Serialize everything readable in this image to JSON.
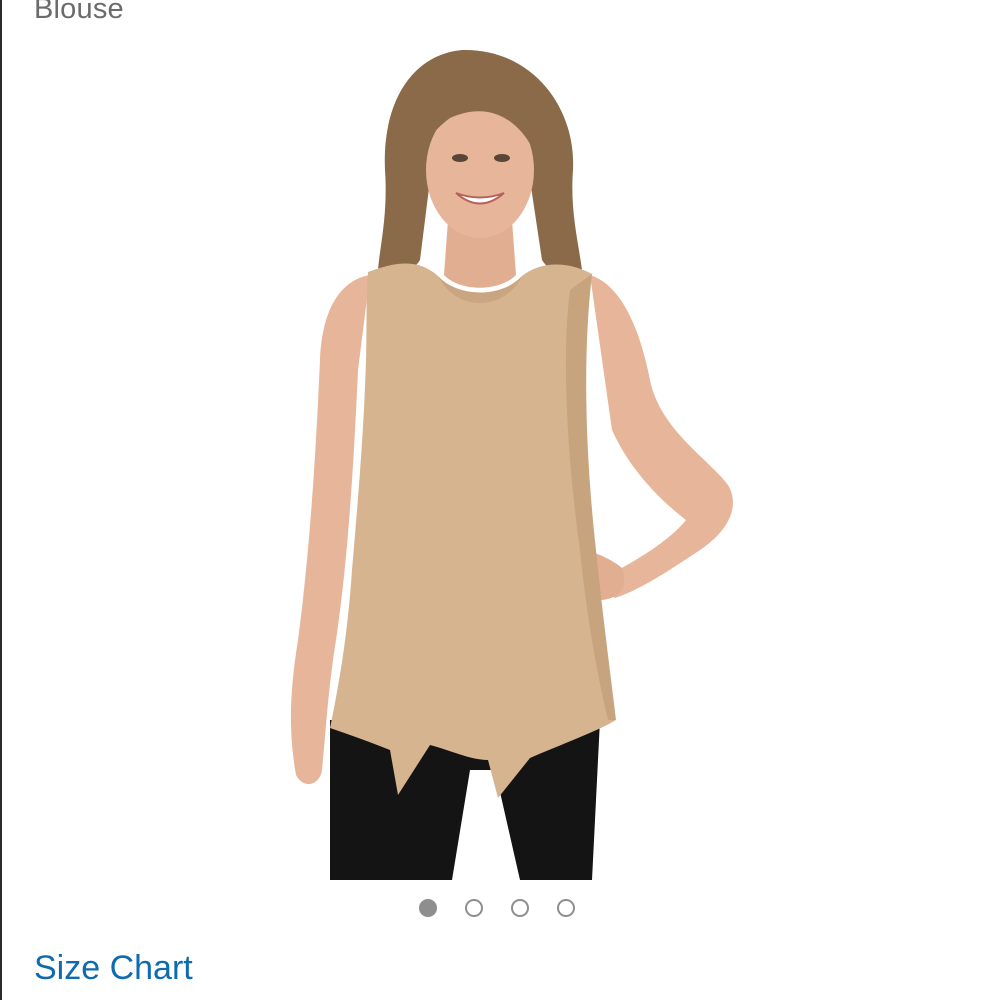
{
  "product": {
    "title": "Blouse"
  },
  "image": {
    "subject": "woman-wearing-sleeveless-tan-blouse",
    "colors": {
      "blouse": "#d6b48f",
      "pants": "#141414",
      "skin": "#e7b69a",
      "hair": "#8a6a48"
    }
  },
  "carousel": {
    "total": 4,
    "active_index": 0
  },
  "links": {
    "size_chart": "Size Chart"
  },
  "colors": {
    "link": "#0f6bb0",
    "title_text": "#6b6b6b",
    "dot": "#8e8e8e"
  }
}
